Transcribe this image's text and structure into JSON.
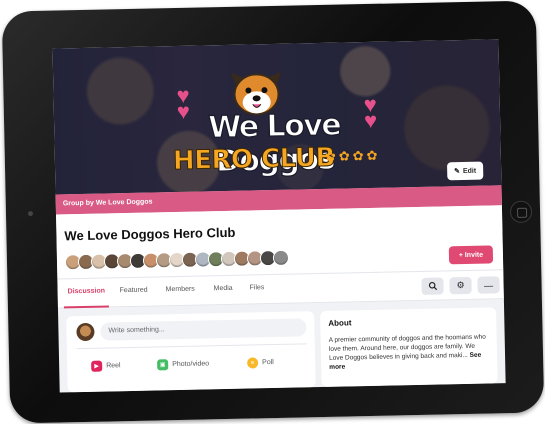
{
  "cover": {
    "logo_line1": "We Love Doggos",
    "logo_line2": "HERO CLUB",
    "edit_label": "Edit"
  },
  "group_by": "Group by We Love Doggos",
  "group": {
    "title": "We Love Doggos Hero Club",
    "member_avatar_colors": [
      "#c9a07a",
      "#8b6b4f",
      "#d8c1a8",
      "#5b4536",
      "#a88b6e",
      "#3e3a38",
      "#c7906b",
      "#b59b84",
      "#e4d6c8",
      "#7c6452",
      "#aeb7c2",
      "#6f7f5b",
      "#d2c7bd",
      "#9e7b60",
      "#b49584",
      "#4a4846",
      "#8a8a8a"
    ],
    "invite_label": "+ Invite"
  },
  "tabs": [
    {
      "label": "Discussion",
      "active": true
    },
    {
      "label": "Featured",
      "active": false
    },
    {
      "label": "Members",
      "active": false
    },
    {
      "label": "Media",
      "active": false
    },
    {
      "label": "Files",
      "active": false
    }
  ],
  "tools": [
    "search-icon",
    "gear-icon",
    "more-icon"
  ],
  "composer": {
    "placeholder": "Write something...",
    "actions": [
      {
        "label": "Reel",
        "icon": "reel-icon",
        "color": "#e0245e"
      },
      {
        "label": "Photo/video",
        "icon": "photo-icon",
        "color": "#45bd62"
      },
      {
        "label": "Poll",
        "icon": "poll-icon",
        "color": "#f7b928"
      }
    ]
  },
  "about": {
    "title": "About",
    "text": "A premier community of doggos and the hoomans who love them. Around here, our doggos are family. We Love Doggos believes in giving back and maki...",
    "see_more": "See more"
  },
  "colors": {
    "accent": "#d95a85",
    "invite": "#e04a72"
  }
}
